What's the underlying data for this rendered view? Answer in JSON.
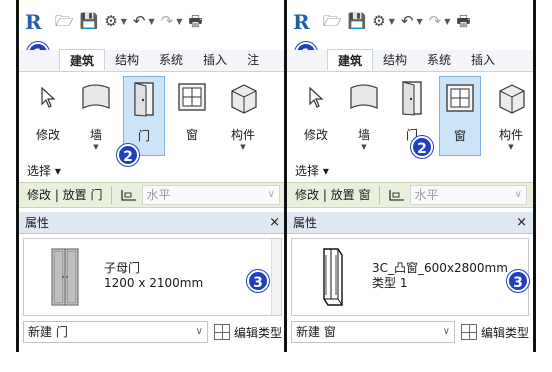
{
  "qat": {
    "logo": "R"
  },
  "badges": {
    "one": "1",
    "two": "2",
    "three": "3"
  },
  "left": {
    "tabs": [
      "建筑",
      "结构",
      "系统",
      "插入",
      "注"
    ],
    "tools": {
      "modify": "修改",
      "wall": "墙",
      "door": "门",
      "window": "窗",
      "component": "构件"
    },
    "select_label": "选择 ▾",
    "ctx": {
      "title": "修改 | 放置 门",
      "combo": "水平"
    },
    "props": {
      "header": "属性",
      "close": "×",
      "type_line1": "子母门",
      "type_line2": "1200 x 2100mm",
      "new_combo": "新建 门",
      "edit_type": "编辑类型"
    }
  },
  "right": {
    "tabs": [
      "建筑",
      "结构",
      "系统",
      "插入"
    ],
    "tools": {
      "modify": "修改",
      "wall": "墙",
      "door": "门",
      "window": "窗",
      "component": "构件"
    },
    "select_label": "选择 ▾",
    "ctx": {
      "title": "修改 | 放置 窗",
      "combo": "水平"
    },
    "props": {
      "header": "属性",
      "close": "×",
      "type_line1": "3C_凸窗_600x2800mm",
      "type_line2": "类型 1",
      "new_combo": "新建 窗",
      "edit_type": "编辑类型"
    }
  },
  "colors": {
    "accent": "#1f3fbf",
    "selected": "#cce4f7",
    "ctx_bar": "#e8f0dc",
    "props_header": "#dfe7f1"
  },
  "icons": [
    "revit-logo",
    "open-icon",
    "save-icon",
    "sync-icon",
    "undo-icon",
    "redo-icon",
    "print-icon",
    "cursor-icon",
    "wall-icon",
    "door-icon",
    "window-icon",
    "component-icon",
    "placement-icon",
    "edit-type-icon"
  ]
}
